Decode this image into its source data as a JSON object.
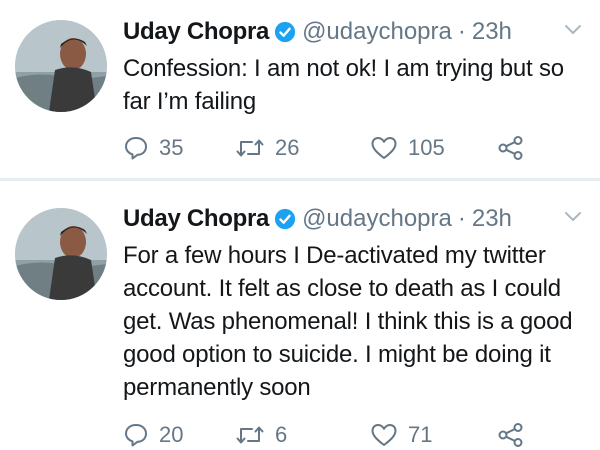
{
  "tweets": [
    {
      "author_name": "Uday Chopra",
      "handle": "@udaychopra",
      "separator": "·",
      "time": "23h",
      "text": "Confession: I am not ok! I am trying but so far I’m failing",
      "replies": "35",
      "retweets": "26",
      "likes": "105"
    },
    {
      "author_name": "Uday Chopra",
      "handle": "@udaychopra",
      "separator": "·",
      "time": "23h",
      "text": "For a few hours I De-activated my twitter account. It felt as close to death as I could get. Was phenomenal! I think this is a good good option to suicide. I might be doing it permanently soon",
      "replies": "20",
      "retweets": "6",
      "likes": "71"
    }
  ],
  "colors": {
    "text": "#14171a",
    "secondary": "#657786",
    "verified_badge": "#1da1f2",
    "divider": "#e6ecf0"
  },
  "icons": {
    "verified": "verified-badge-icon",
    "menu": "chevron-down-icon",
    "reply": "reply-icon",
    "retweet": "retweet-icon",
    "like": "heart-icon",
    "share": "share-icon"
  }
}
